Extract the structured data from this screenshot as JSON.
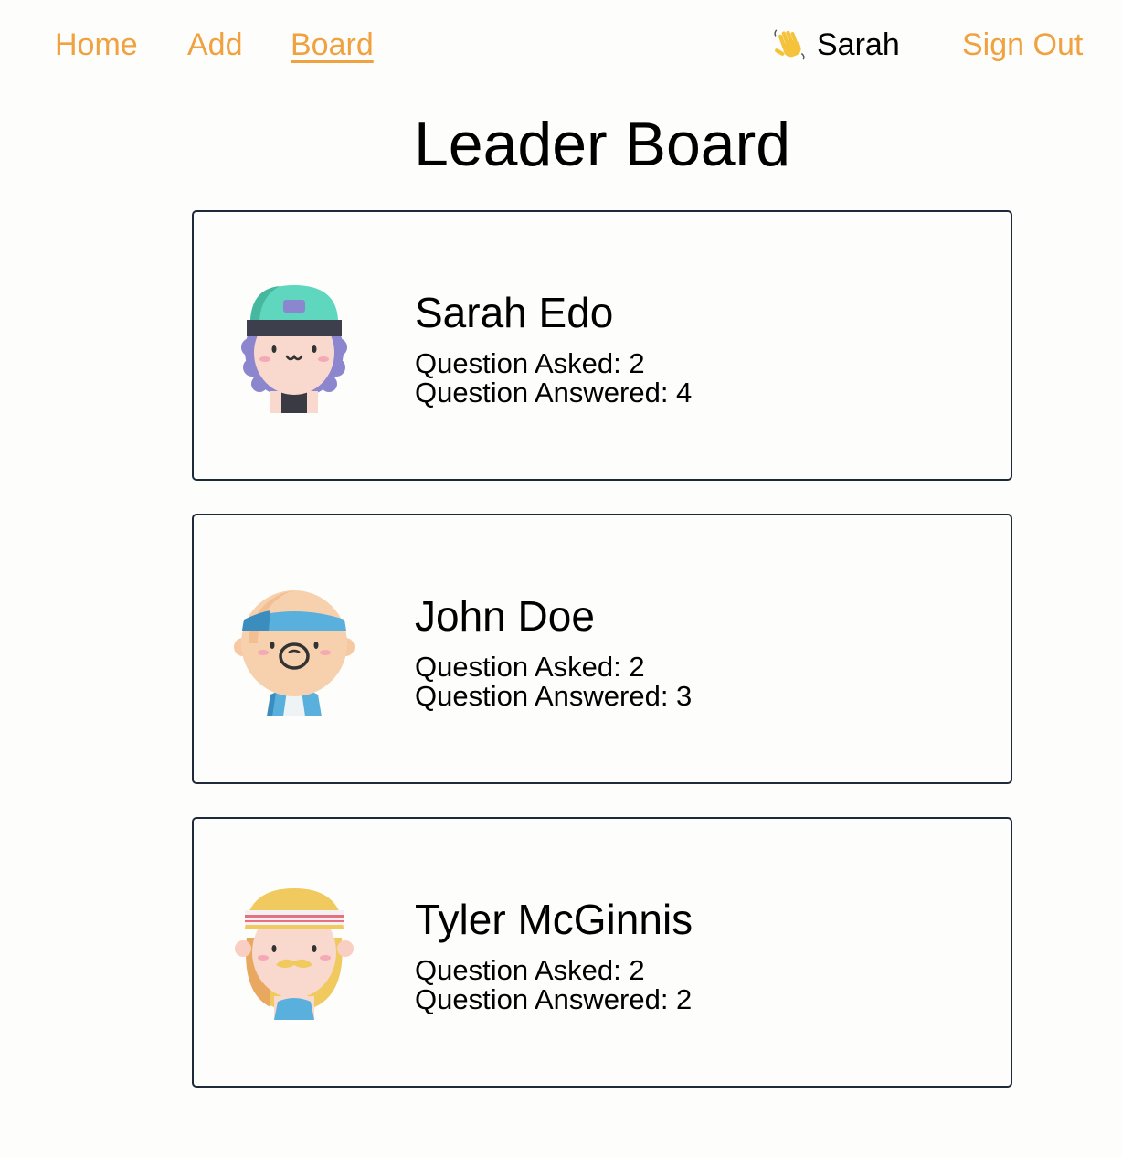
{
  "nav": {
    "home_label": "Home",
    "add_label": "Add",
    "board_label": "Board",
    "user_name": "Sarah",
    "signout_label": "Sign Out"
  },
  "page": {
    "title": "Leader Board"
  },
  "leaders": [
    {
      "name": "Sarah Edo",
      "asked_label": "Question Asked: 2",
      "answered_label": "Question Answered: 4",
      "avatar": "girl-cap-avatar"
    },
    {
      "name": "John Doe",
      "asked_label": "Question Asked: 2",
      "answered_label": "Question Answered: 3",
      "avatar": "boy-headband-avatar"
    },
    {
      "name": "Tyler McGinnis",
      "asked_label": "Question Asked: 2",
      "answered_label": "Question Answered: 2",
      "avatar": "mustache-headband-avatar"
    }
  ],
  "colors": {
    "link": "#f0a140",
    "card_border": "#1e2a3a",
    "background": "#fdfdfb"
  }
}
